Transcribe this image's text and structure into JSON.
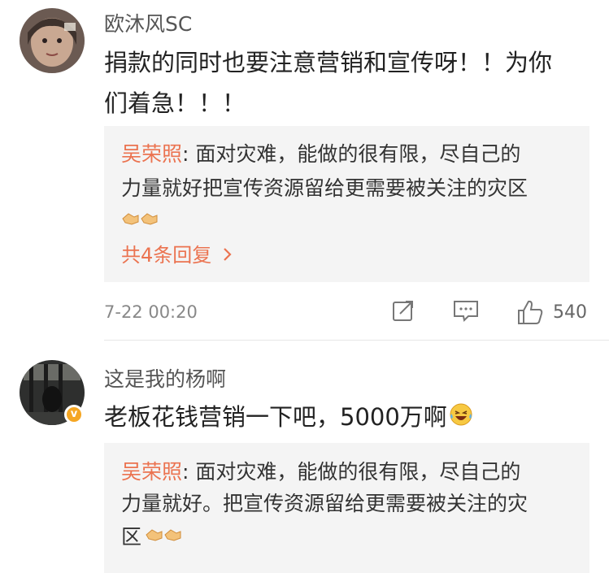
{
  "comments": [
    {
      "username": "欧沐风SC",
      "text_line1": "捐款的同时也要注意营销和宣传呀！！为你",
      "text_line2": "们着急！！！",
      "reply": {
        "author": "吴荣照",
        "colon": ": ",
        "line1": "面对灾难，能做的很有限，尽自己的",
        "line2": "力量就好把宣传资源留给更需要被关注的灾区",
        "emoji": "handshake-emoji",
        "more_label": "共4条回复",
        "more_icon": "chevron-right-icon"
      },
      "time": "7-22 00:20",
      "actions": {
        "share_icon": "share-icon",
        "comment_icon": "comment-icon",
        "like_icon": "thumbs-up-icon",
        "like_count": "540"
      }
    },
    {
      "username": "这是我的杨啊",
      "verified_badge": "v",
      "text": "老板花钱营销一下吧，5000万啊",
      "text_emoji": "laughing-tears-emoji",
      "reply": {
        "author": "吴荣照",
        "colon": ": ",
        "line1": "面对灾难，能做的很有限，尽自己的",
        "line2": "力量就好。把宣传资源留给更需要被关注的灾",
        "line3": "区",
        "emoji": "handshake-emoji"
      }
    }
  ],
  "colors": {
    "accent": "#eb7350",
    "badge": "#f5a623",
    "reply_bg": "#f4f4f4"
  }
}
